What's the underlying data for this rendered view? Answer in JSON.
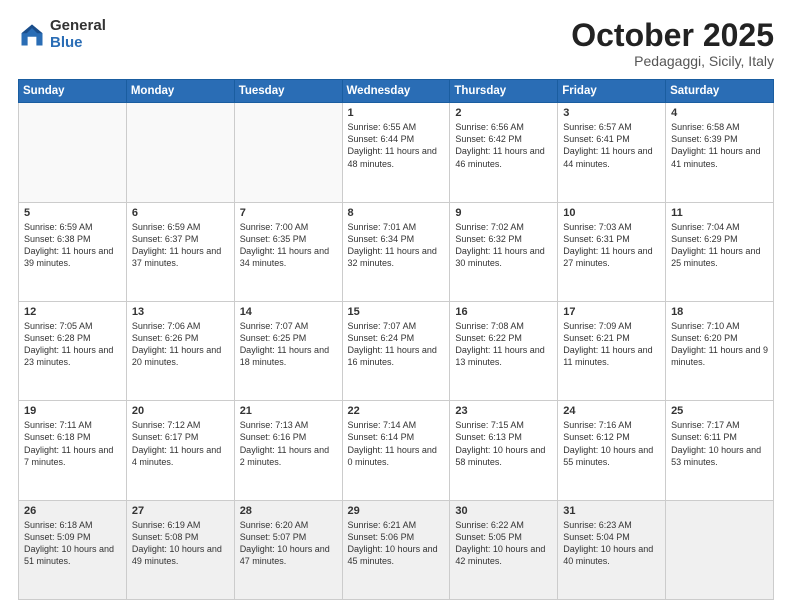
{
  "header": {
    "logo_general": "General",
    "logo_blue": "Blue",
    "month_title": "October 2025",
    "location": "Pedagaggi, Sicily, Italy"
  },
  "weekdays": [
    "Sunday",
    "Monday",
    "Tuesday",
    "Wednesday",
    "Thursday",
    "Friday",
    "Saturday"
  ],
  "weeks": [
    [
      {
        "day": "",
        "info": ""
      },
      {
        "day": "",
        "info": ""
      },
      {
        "day": "",
        "info": ""
      },
      {
        "day": "1",
        "info": "Sunrise: 6:55 AM\nSunset: 6:44 PM\nDaylight: 11 hours\nand 48 minutes."
      },
      {
        "day": "2",
        "info": "Sunrise: 6:56 AM\nSunset: 6:42 PM\nDaylight: 11 hours\nand 46 minutes."
      },
      {
        "day": "3",
        "info": "Sunrise: 6:57 AM\nSunset: 6:41 PM\nDaylight: 11 hours\nand 44 minutes."
      },
      {
        "day": "4",
        "info": "Sunrise: 6:58 AM\nSunset: 6:39 PM\nDaylight: 11 hours\nand 41 minutes."
      }
    ],
    [
      {
        "day": "5",
        "info": "Sunrise: 6:59 AM\nSunset: 6:38 PM\nDaylight: 11 hours\nand 39 minutes."
      },
      {
        "day": "6",
        "info": "Sunrise: 6:59 AM\nSunset: 6:37 PM\nDaylight: 11 hours\nand 37 minutes."
      },
      {
        "day": "7",
        "info": "Sunrise: 7:00 AM\nSunset: 6:35 PM\nDaylight: 11 hours\nand 34 minutes."
      },
      {
        "day": "8",
        "info": "Sunrise: 7:01 AM\nSunset: 6:34 PM\nDaylight: 11 hours\nand 32 minutes."
      },
      {
        "day": "9",
        "info": "Sunrise: 7:02 AM\nSunset: 6:32 PM\nDaylight: 11 hours\nand 30 minutes."
      },
      {
        "day": "10",
        "info": "Sunrise: 7:03 AM\nSunset: 6:31 PM\nDaylight: 11 hours\nand 27 minutes."
      },
      {
        "day": "11",
        "info": "Sunrise: 7:04 AM\nSunset: 6:29 PM\nDaylight: 11 hours\nand 25 minutes."
      }
    ],
    [
      {
        "day": "12",
        "info": "Sunrise: 7:05 AM\nSunset: 6:28 PM\nDaylight: 11 hours\nand 23 minutes."
      },
      {
        "day": "13",
        "info": "Sunrise: 7:06 AM\nSunset: 6:26 PM\nDaylight: 11 hours\nand 20 minutes."
      },
      {
        "day": "14",
        "info": "Sunrise: 7:07 AM\nSunset: 6:25 PM\nDaylight: 11 hours\nand 18 minutes."
      },
      {
        "day": "15",
        "info": "Sunrise: 7:07 AM\nSunset: 6:24 PM\nDaylight: 11 hours\nand 16 minutes."
      },
      {
        "day": "16",
        "info": "Sunrise: 7:08 AM\nSunset: 6:22 PM\nDaylight: 11 hours\nand 13 minutes."
      },
      {
        "day": "17",
        "info": "Sunrise: 7:09 AM\nSunset: 6:21 PM\nDaylight: 11 hours\nand 11 minutes."
      },
      {
        "day": "18",
        "info": "Sunrise: 7:10 AM\nSunset: 6:20 PM\nDaylight: 11 hours\nand 9 minutes."
      }
    ],
    [
      {
        "day": "19",
        "info": "Sunrise: 7:11 AM\nSunset: 6:18 PM\nDaylight: 11 hours\nand 7 minutes."
      },
      {
        "day": "20",
        "info": "Sunrise: 7:12 AM\nSunset: 6:17 PM\nDaylight: 11 hours\nand 4 minutes."
      },
      {
        "day": "21",
        "info": "Sunrise: 7:13 AM\nSunset: 6:16 PM\nDaylight: 11 hours\nand 2 minutes."
      },
      {
        "day": "22",
        "info": "Sunrise: 7:14 AM\nSunset: 6:14 PM\nDaylight: 11 hours\nand 0 minutes."
      },
      {
        "day": "23",
        "info": "Sunrise: 7:15 AM\nSunset: 6:13 PM\nDaylight: 10 hours\nand 58 minutes."
      },
      {
        "day": "24",
        "info": "Sunrise: 7:16 AM\nSunset: 6:12 PM\nDaylight: 10 hours\nand 55 minutes."
      },
      {
        "day": "25",
        "info": "Sunrise: 7:17 AM\nSunset: 6:11 PM\nDaylight: 10 hours\nand 53 minutes."
      }
    ],
    [
      {
        "day": "26",
        "info": "Sunrise: 6:18 AM\nSunset: 5:09 PM\nDaylight: 10 hours\nand 51 minutes."
      },
      {
        "day": "27",
        "info": "Sunrise: 6:19 AM\nSunset: 5:08 PM\nDaylight: 10 hours\nand 49 minutes."
      },
      {
        "day": "28",
        "info": "Sunrise: 6:20 AM\nSunset: 5:07 PM\nDaylight: 10 hours\nand 47 minutes."
      },
      {
        "day": "29",
        "info": "Sunrise: 6:21 AM\nSunset: 5:06 PM\nDaylight: 10 hours\nand 45 minutes."
      },
      {
        "day": "30",
        "info": "Sunrise: 6:22 AM\nSunset: 5:05 PM\nDaylight: 10 hours\nand 42 minutes."
      },
      {
        "day": "31",
        "info": "Sunrise: 6:23 AM\nSunset: 5:04 PM\nDaylight: 10 hours\nand 40 minutes."
      },
      {
        "day": "",
        "info": ""
      }
    ]
  ]
}
